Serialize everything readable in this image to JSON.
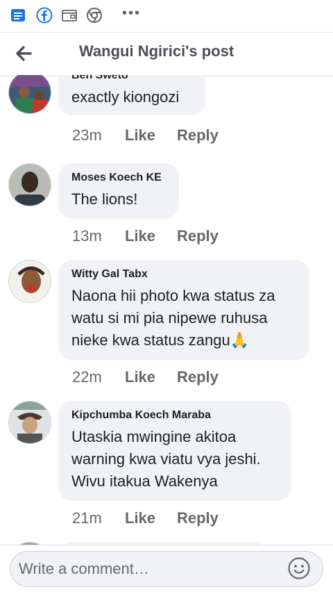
{
  "header": {
    "title": "Wangui Ngirici's post"
  },
  "comments": [
    {
      "author": "Ben Sweto",
      "text": "exactly kiongozi",
      "time": "23m",
      "like": "Like",
      "reply": "Reply"
    },
    {
      "author": "Moses Koech KE",
      "text": "The lions!",
      "time": "13m",
      "like": "Like",
      "reply": "Reply"
    },
    {
      "author": "Witty Gal Tabx",
      "text": "Naona hii photo kwa status za\nwatu si mi pia nipewe ruhusa\nnieke kwa status zangu🙏",
      "time": "22m",
      "like": "Like",
      "reply": "Reply"
    },
    {
      "author": "Kipchumba Koech Maraba",
      "text": "Utaskia mwingine akitoa\nwarning kwa viatu vya jeshi.\nWivu itakua Wakenya",
      "time": "21m",
      "like": "Like",
      "reply": "Reply"
    }
  ],
  "composer": {
    "placeholder": "Write a comment…"
  },
  "colors": {
    "accent": "#1877f2",
    "bubble": "#f0f2f5",
    "meta": "#65676b"
  }
}
